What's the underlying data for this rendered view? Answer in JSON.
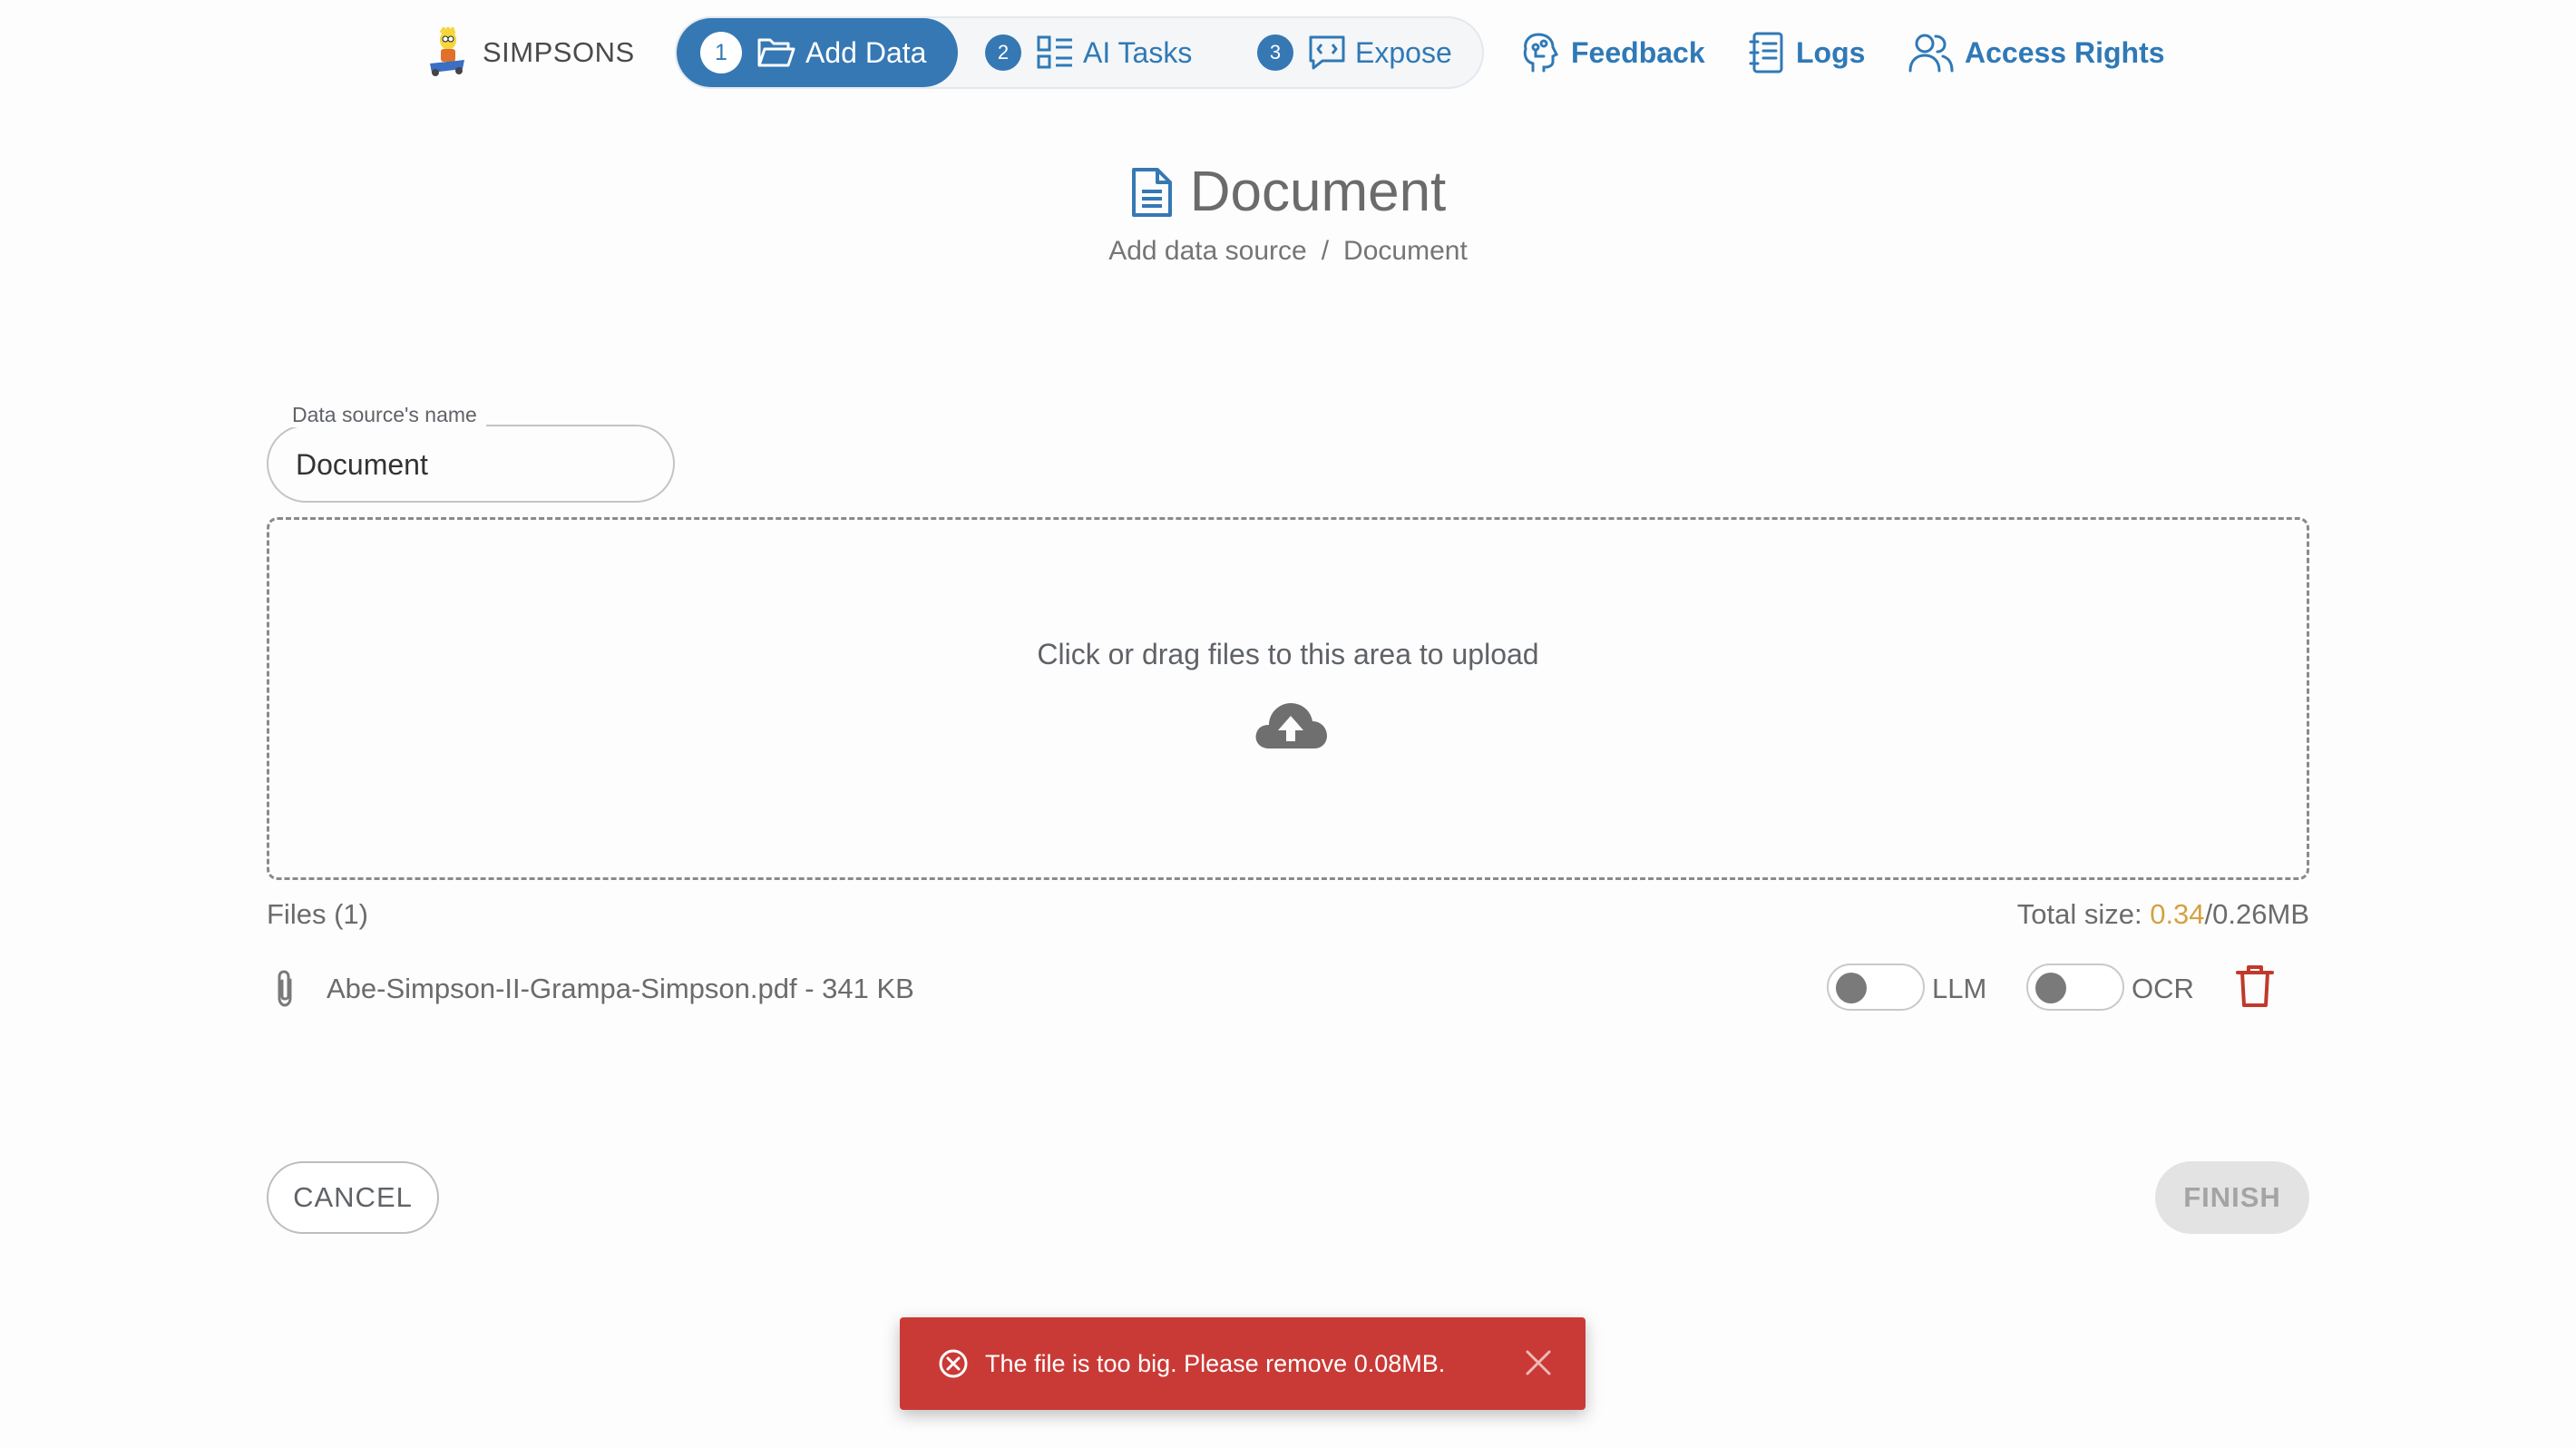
{
  "brand": {
    "name": "SIMPSONS",
    "logo_icon": "simpsons-character-logo"
  },
  "stepper": {
    "steps": [
      {
        "number": "1",
        "label": "Add Data",
        "icon": "folder-open-icon",
        "active": true
      },
      {
        "number": "2",
        "label": "AI Tasks",
        "icon": "tasks-list-icon",
        "active": false
      },
      {
        "number": "3",
        "label": "Expose",
        "icon": "chat-bubble-icon",
        "active": false
      }
    ]
  },
  "nav": {
    "feedback": "Feedback",
    "logs": "Logs",
    "access_rights": "Access Rights"
  },
  "header": {
    "title": "Document",
    "breadcrumb": {
      "parent": "Add data source",
      "separator": "/",
      "current": "Document"
    }
  },
  "form": {
    "name_label": "Data source's name",
    "name_value": "Document"
  },
  "dropzone": {
    "text": "Click or drag files to this area to upload",
    "icon": "cloud-upload-icon"
  },
  "files": {
    "count_label": "Files (1)",
    "total_prefix": "Total size: ",
    "total_used": "0.34",
    "total_limit": "/0.26MB",
    "items": [
      {
        "name": "Abe-Simpson-II-Grampa-Simpson.pdf - 341 KB",
        "llm_label": "LLM",
        "llm_on": false,
        "ocr_label": "OCR",
        "ocr_on": false
      }
    ]
  },
  "actions": {
    "cancel": "CANCEL",
    "finish": "FINISH"
  },
  "toast": {
    "message": "The file is too big. Please remove 0.08MB.",
    "type": "error"
  },
  "colors": {
    "primary": "#3578b4",
    "warning": "#d4a240",
    "error": "#c93a36",
    "delete": "#c0392b"
  }
}
